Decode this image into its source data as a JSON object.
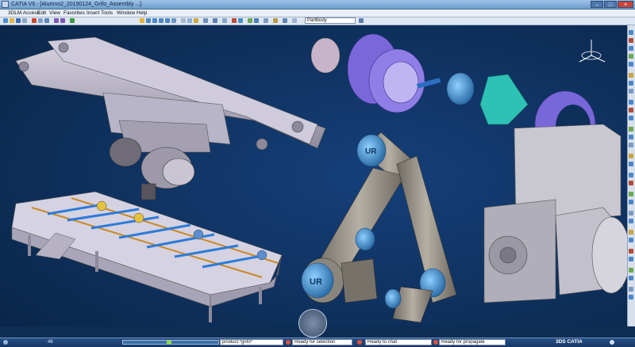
{
  "window": {
    "title": "CATIA V6 - [Alumno2_20190124_Grifo_Assembly ...]",
    "buttons": [
      "–",
      "□",
      "×"
    ]
  },
  "menubar": {
    "items": [
      "3DLM Access",
      "Edit",
      "View",
      "Favorites",
      "Insert",
      "Tools",
      "Window",
      "Help"
    ]
  },
  "toolbar": {
    "part_selector": "PartBody"
  },
  "viewport": {
    "background_color": "#0d2d55",
    "robot_logo": "UR",
    "objects": [
      "conveyor-frame",
      "roller-conveyor",
      "robot-arm",
      "gripper-parts",
      "gearbox-motor"
    ]
  },
  "statusbar": {
    "left_number": "46",
    "product_field": "product.*grifo*",
    "fields": [
      "Ready for selection",
      "Ready to chat",
      "Ready for propagate"
    ],
    "brand": "3DS CATIA",
    "progress_fraction": 0.48
  }
}
